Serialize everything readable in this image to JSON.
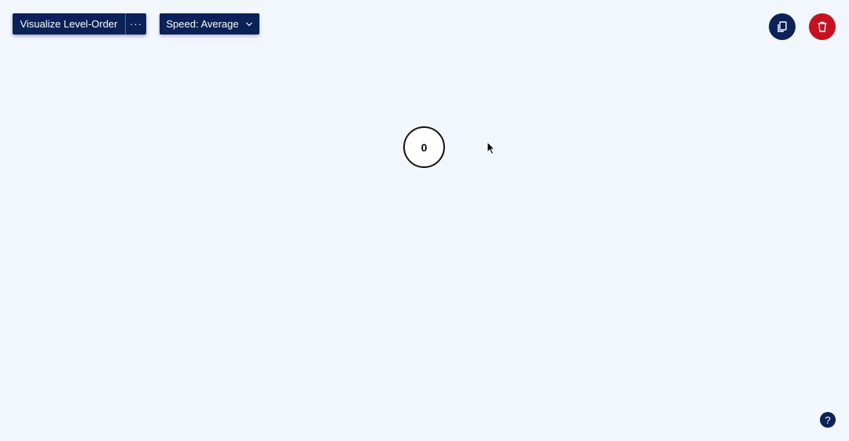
{
  "toolbar": {
    "visualize_label": "Visualize Level-Order",
    "more_label": "···",
    "speed_label": "Speed: Average"
  },
  "actions": {
    "copy_icon": "copy-icon",
    "delete_icon": "trash-icon"
  },
  "help": {
    "label": "?"
  },
  "tree": {
    "nodes": [
      {
        "value": "0"
      }
    ]
  },
  "colors": {
    "primary": "#0b2259",
    "danger": "#c8101e",
    "background": "#f2f6fd"
  }
}
